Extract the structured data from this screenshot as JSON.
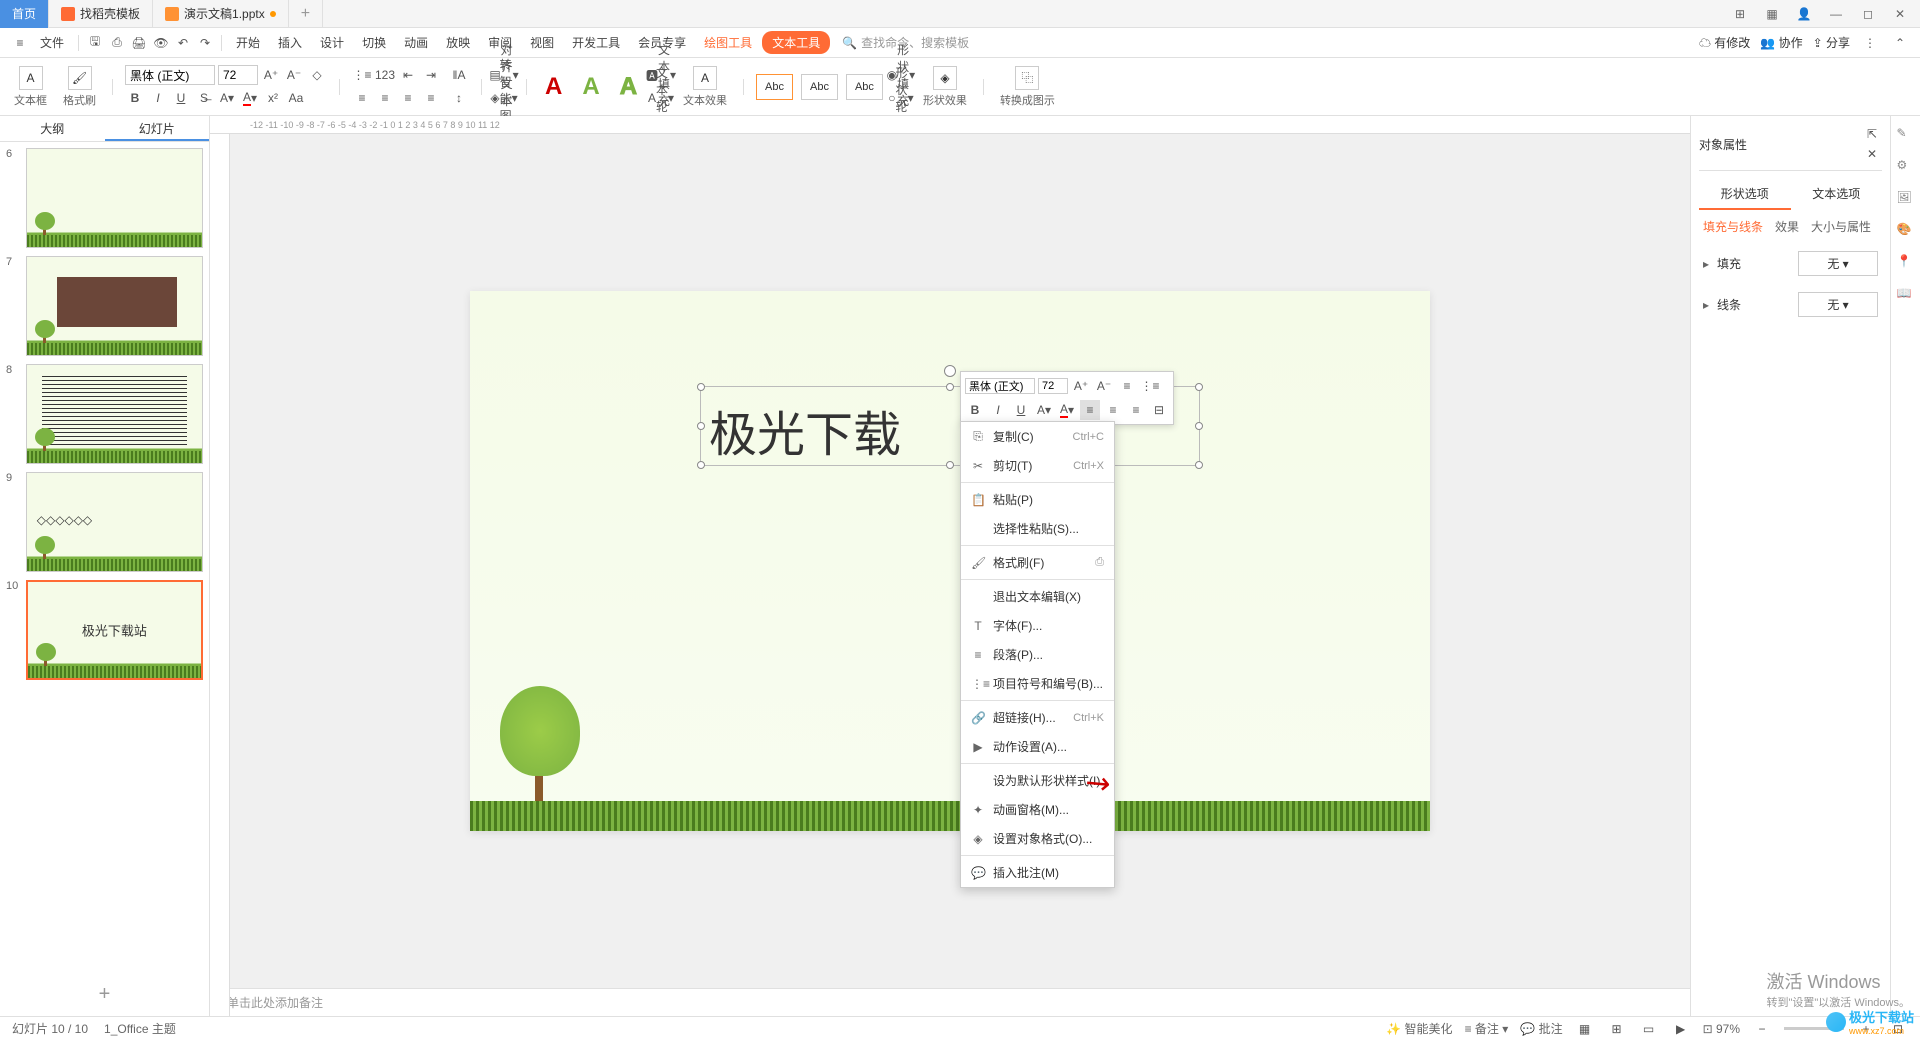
{
  "tabs": {
    "home": "首页",
    "t1": "找稻壳模板",
    "t2": "演示文稿1.pptx"
  },
  "menubar": {
    "file": "文件",
    "items": [
      "开始",
      "插入",
      "设计",
      "切换",
      "动画",
      "放映",
      "审阅",
      "视图",
      "开发工具",
      "会员专享"
    ],
    "draw_tool": "绘图工具",
    "text_tool": "文本工具",
    "search_placeholder": "查找命令、搜索模板",
    "right": {
      "pending": "有修改",
      "coop": "协作",
      "share": "分享"
    }
  },
  "toolbar": {
    "textbox": "文本框",
    "format_brush": "格式刷",
    "font": "黑体 (正文)",
    "size": "72",
    "align_text": "对齐文本",
    "smart_shape": "转智能图形",
    "text_fill": "文本填充",
    "text_outline": "文本轮廓",
    "text_effect": "文本效果",
    "shape_fill": "形状填充",
    "shape_outline": "形状轮廓",
    "shape_effect": "形状效果",
    "to_diagram": "转换成图示",
    "abc": "Abc"
  },
  "slide_tabs": {
    "outline": "大纲",
    "slides": "幻灯片"
  },
  "thumbs": [
    {
      "n": "6"
    },
    {
      "n": "7"
    },
    {
      "n": "8"
    },
    {
      "n": "9"
    },
    {
      "n": "10",
      "text": "极光下载站",
      "active": true
    }
  ],
  "canvas_text": "极光下载",
  "float_toolbar": {
    "font": "黑体 (正文)",
    "size": "72"
  },
  "context_menu": [
    {
      "icon": "⎘",
      "label": "复制(C)",
      "sc": "Ctrl+C"
    },
    {
      "icon": "✂",
      "label": "剪切(T)",
      "sc": "Ctrl+X"
    },
    {
      "sep": true
    },
    {
      "icon": "📋",
      "label": "粘贴(P)"
    },
    {
      "icon": "",
      "label": "选择性粘贴(S)..."
    },
    {
      "sep": true
    },
    {
      "icon": "🖌",
      "label": "格式刷(F)",
      "right_icon": "⎙"
    },
    {
      "sep": true
    },
    {
      "icon": "",
      "label": "退出文本编辑(X)"
    },
    {
      "icon": "T",
      "label": "字体(F)..."
    },
    {
      "icon": "≡",
      "label": "段落(P)..."
    },
    {
      "icon": "⋮≡",
      "label": "项目符号和编号(B)..."
    },
    {
      "sep": true
    },
    {
      "icon": "🔗",
      "label": "超链接(H)...",
      "sc": "Ctrl+K"
    },
    {
      "icon": "▶",
      "label": "动作设置(A)..."
    },
    {
      "sep": true
    },
    {
      "icon": "",
      "label": "设为默认形状样式(I)"
    },
    {
      "icon": "✦",
      "label": "动画窗格(M)..."
    },
    {
      "icon": "◈",
      "label": "设置对象格式(O)..."
    },
    {
      "sep": true
    },
    {
      "icon": "💬",
      "label": "插入批注(M)"
    }
  ],
  "notes": "单击此处添加备注",
  "right_panel": {
    "title": "对象属性",
    "tab1": "形状选项",
    "tab2": "文本选项",
    "sub1": "填充与线条",
    "sub2": "效果",
    "sub3": "大小与属性",
    "fill": "填充",
    "line": "线条",
    "none": "无"
  },
  "status": {
    "slide": "幻灯片 10 / 10",
    "theme": "1_Office 主题",
    "beautify": "智能美化",
    "notes": "备注",
    "comments": "批注",
    "zoom": "97%"
  },
  "watermark": {
    "w1": "激活 Windows",
    "w2": "转到\"设置\"以激活 Windows。"
  },
  "brand": {
    "name": "极光下载站",
    "url": "www.xz7.com"
  }
}
